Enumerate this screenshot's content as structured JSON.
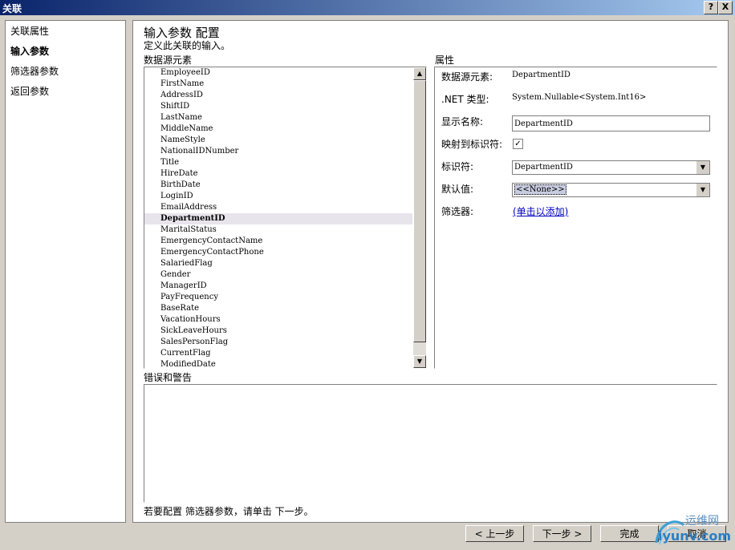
{
  "window": {
    "title": "关联",
    "help_glyph": "?",
    "close_glyph": "X"
  },
  "nav": {
    "items": [
      {
        "label": "关联属性",
        "active": false
      },
      {
        "label": "输入参数",
        "active": true
      },
      {
        "label": "筛选器参数",
        "active": false
      },
      {
        "label": "返回参数",
        "active": false
      }
    ]
  },
  "page": {
    "title": "输入参数 配置",
    "description": "定义此关联的输入。"
  },
  "source": {
    "label": "数据源元素",
    "items": [
      "EmployeeID",
      "FirstName",
      "AddressID",
      "ShiftID",
      "LastName",
      "MiddleName",
      "NameStyle",
      "NationalIDNumber",
      "Title",
      "HireDate",
      "BirthDate",
      "LoginID",
      "EmailAddress",
      "DepartmentID",
      "MaritalStatus",
      "EmergencyContactName",
      "EmergencyContactPhone",
      "SalariedFlag",
      "Gender",
      "ManagerID",
      "PayFrequency",
      "BaseRate",
      "VacationHours",
      "SickLeaveHours",
      "SalesPersonFlag",
      "CurrentFlag",
      "ModifiedDate"
    ],
    "selected": "DepartmentID",
    "scroll_up_glyph": "▲",
    "scroll_down_glyph": "▼"
  },
  "properties": {
    "label": "属性",
    "element_label": "数据源元素:",
    "element_value": "DepartmentID",
    "type_label": ".NET 类型:",
    "type_value": "System.Nullable<System.Int16>",
    "display_label": "显示名称:",
    "display_value": "DepartmentID",
    "map_label": "映射到标识符:",
    "map_checked": true,
    "check_glyph": "✓",
    "identifier_label": "标识符:",
    "identifier_value": "DepartmentID",
    "default_label": "默认值:",
    "default_value": "<<None>>",
    "filter_label": "筛选器:",
    "filter_link": "(单击以添加)",
    "dropdown_glyph": "▼"
  },
  "errors": {
    "label": "错误和警告"
  },
  "hint": "若要配置 筛选器参数，请单击 下一步。",
  "buttons": {
    "back": "< 上一步",
    "next": "下一步 >",
    "finish": "完成",
    "cancel": "取消"
  },
  "watermark": {
    "top": "运维网",
    "bottom": "iyunv.com"
  }
}
